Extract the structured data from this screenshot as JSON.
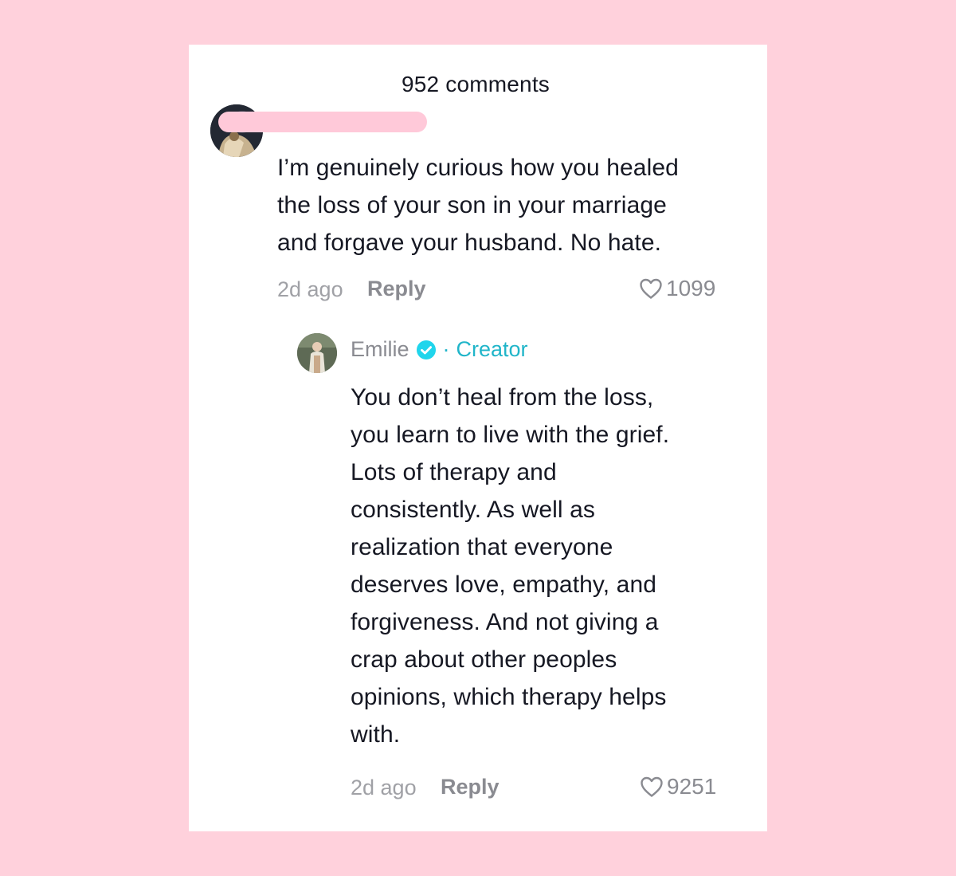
{
  "header": {
    "comments_count": "952 comments"
  },
  "comments": [
    {
      "text": "I’m genuinely curious how you healed\nthe loss of your son in your marriage\nand forgave your husband. No hate.",
      "time": "2d ago",
      "reply_label": "Reply",
      "likes": "1099"
    },
    {
      "author": "Emilie",
      "separator": "·",
      "role": "Creator",
      "text": "You don’t heal from the loss,\nyou learn to live with the grief.\nLots of therapy and\nconsistently. As well as\nrealization that everyone\ndeserves love, empathy, and\nforgiveness. And not giving a\ncrap about other peoples\nopinions, which therapy helps\nwith.",
      "time": "2d ago",
      "reply_label": "Reply",
      "likes": "9251"
    }
  ],
  "colors": {
    "background": "#ffd1dc",
    "text": "#161823",
    "muted": "#8a8b91",
    "creator": "#20b5c9",
    "verified": "#20d5ec"
  },
  "icons": [
    "heart-icon",
    "verified-badge-icon"
  ]
}
